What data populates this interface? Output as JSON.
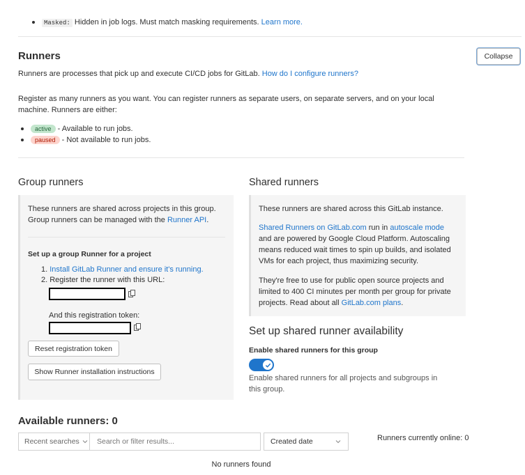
{
  "masked": {
    "code": "Masked:",
    "text": "Hidden in job logs. Must match masking requirements.",
    "link": "Learn more."
  },
  "runners": {
    "title": "Runners",
    "collapse_label": "Collapse",
    "desc": "Runners are processes that pick up and execute CI/CD jobs for GitLab.",
    "desc_link": "How do I configure runners?",
    "register_text": "Register as many runners as you want. You can register runners as separate users, on separate servers, and on your local machine. Runners are either:",
    "states": [
      {
        "badge": "active",
        "text": "- Available to run jobs."
      },
      {
        "badge": "paused",
        "text": "- Not available to run jobs."
      }
    ]
  },
  "group": {
    "title": "Group runners",
    "intro": "These runners are shared across projects in this group. Group runners can be managed with the",
    "api_link": "Runner API",
    "intro_end": ".",
    "setup_title": "Set up a group Runner for a project",
    "step1_num": "1.",
    "step1_link": "Install GitLab Runner and ensure it's running.",
    "step2": "2. Register the runner with this URL:",
    "token_label": "And this registration token:",
    "reset_label": "Reset registration token",
    "show_label": "Show Runner installation instructions"
  },
  "shared": {
    "title": "Shared runners",
    "intro": "These runners are shared across this GitLab instance.",
    "p2_link1": "Shared Runners on GitLab.com",
    "p2_mid": "run in",
    "p2_link2": "autoscale mode",
    "p2_rest": "and are powered by Google Cloud Platform. Autoscaling means reduced wait times to spin up builds, and isolated VMs for each project, thus maximizing security.",
    "p3_text": "They're free to use for public open source projects and limited to 400 CI minutes per month per group for private projects. Read about all",
    "p3_link": "GitLab.com plans",
    "p3_end": ".",
    "avail_title": "Set up shared runner availability",
    "toggle_label": "Enable shared runners for this group",
    "toggle_on": true,
    "toggle_help": "Enable shared runners for all projects and subgroups in this group."
  },
  "available": {
    "title": "Available runners: 0",
    "recent_label": "Recent searches",
    "search_placeholder": "Search or filter results...",
    "sort_value": "Created date",
    "online_text": "Runners currently online: 0",
    "empty_text": "No runners found"
  },
  "colors": {
    "link": "#1f75cb",
    "toggle": "#1f75cb"
  }
}
